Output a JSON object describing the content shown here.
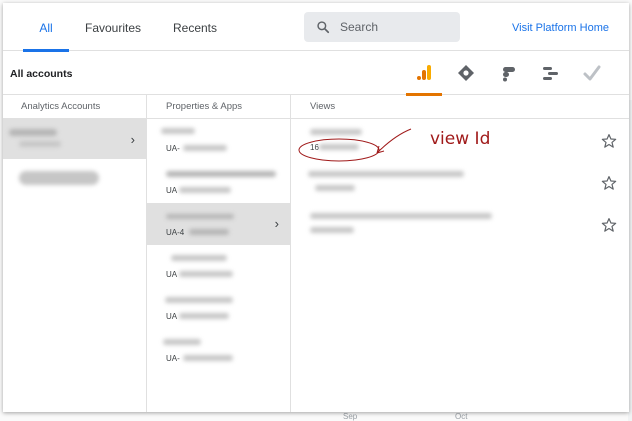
{
  "tabs": [
    {
      "label": "All"
    },
    {
      "label": "Favourites"
    },
    {
      "label": "Recents"
    }
  ],
  "search": {
    "placeholder": "Search"
  },
  "visit_link": "Visit Platform Home",
  "all_accounts": "All accounts",
  "products": [
    {
      "icon": "analytics-icon",
      "active": true
    },
    {
      "icon": "tag-manager-icon"
    },
    {
      "icon": "data-studio-icon"
    },
    {
      "icon": "optimize-icon"
    },
    {
      "icon": "surveys-check-icon"
    }
  ],
  "columns": {
    "accounts": "Analytics Accounts",
    "properties": "Properties & Apps",
    "views": "Views"
  },
  "properties": [
    {
      "ua": "UA-"
    },
    {
      "ua": "UA"
    },
    {
      "ua": "UA-4"
    },
    {
      "ua": "UA"
    },
    {
      "ua": "UA"
    },
    {
      "ua": "UA-"
    }
  ],
  "views": [
    {
      "id": "16"
    },
    {
      "id": ""
    },
    {
      "id": ""
    }
  ],
  "annotation": {
    "text": "view Id",
    "color": "#a01a1a"
  },
  "background_axis": [
    "Sep",
    "Oct"
  ],
  "colors": {
    "accent": "#1a73e8",
    "analytics_orange": "#e37400",
    "selected_row": "#e0e0e0"
  }
}
